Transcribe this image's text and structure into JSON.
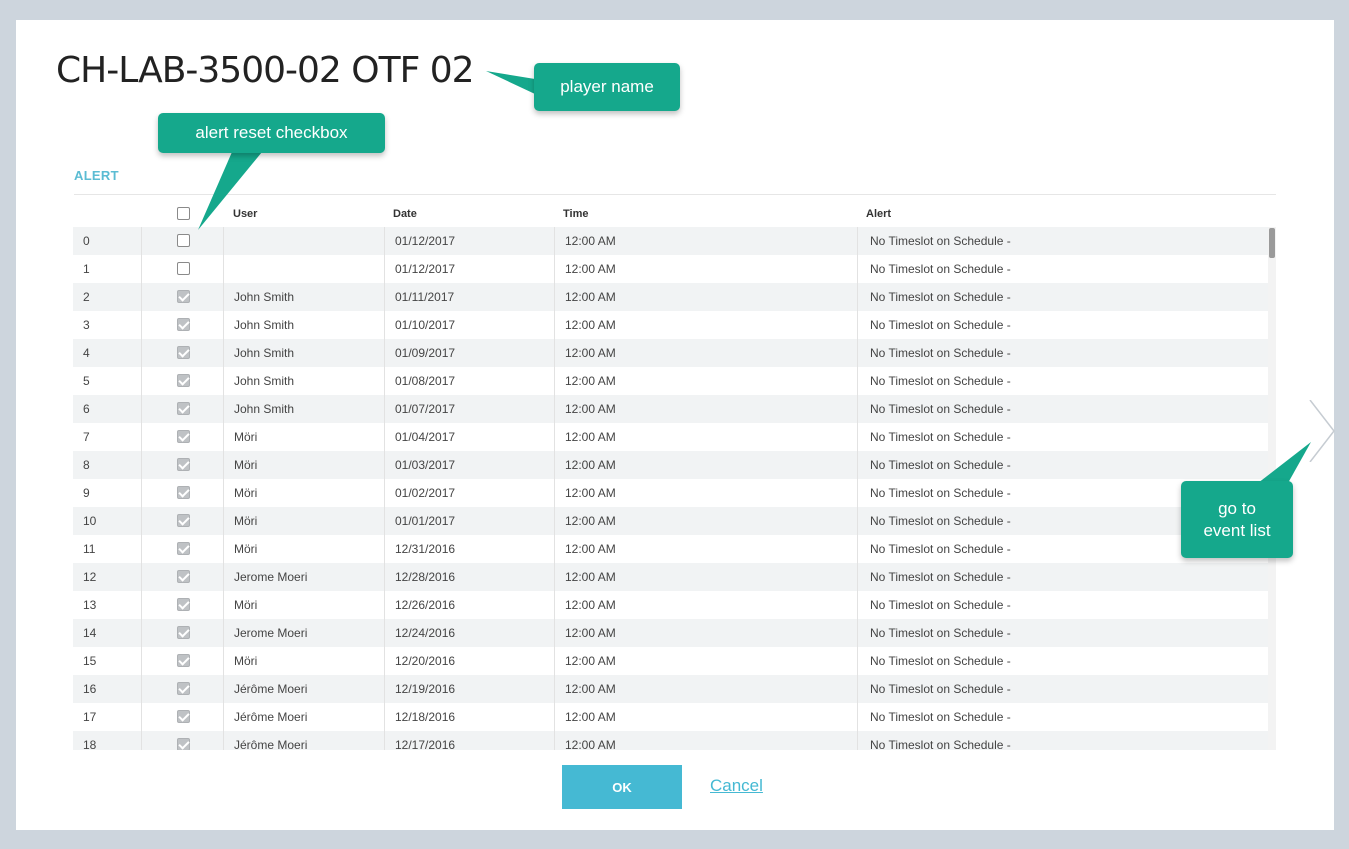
{
  "dialog": {
    "title": "CH-LAB-3500-02 OTF 02",
    "section": "ALERT"
  },
  "table": {
    "columns": {
      "user": "User",
      "date": "Date",
      "time": "Time",
      "alert": "Alert"
    },
    "rows": [
      {
        "idx": "0",
        "checked": false,
        "user": "",
        "date": "01/12/2017",
        "time": "12:00 AM",
        "alert": "No Timeslot on Schedule -"
      },
      {
        "idx": "1",
        "checked": false,
        "user": "",
        "date": "01/12/2017",
        "time": "12:00 AM",
        "alert": "No Timeslot on Schedule -"
      },
      {
        "idx": "2",
        "checked": true,
        "user": "John Smith",
        "date": "01/11/2017",
        "time": "12:00 AM",
        "alert": "No Timeslot on Schedule -"
      },
      {
        "idx": "3",
        "checked": true,
        "user": "John Smith",
        "date": "01/10/2017",
        "time": "12:00 AM",
        "alert": "No Timeslot on Schedule -"
      },
      {
        "idx": "4",
        "checked": true,
        "user": "John Smith",
        "date": "01/09/2017",
        "time": "12:00 AM",
        "alert": "No Timeslot on Schedule -"
      },
      {
        "idx": "5",
        "checked": true,
        "user": "John Smith",
        "date": "01/08/2017",
        "time": "12:00 AM",
        "alert": "No Timeslot on Schedule -"
      },
      {
        "idx": "6",
        "checked": true,
        "user": "John Smith",
        "date": "01/07/2017",
        "time": "12:00 AM",
        "alert": "No Timeslot on Schedule -"
      },
      {
        "idx": "7",
        "checked": true,
        "user": "Möri",
        "date": "01/04/2017",
        "time": "12:00 AM",
        "alert": "No Timeslot on Schedule -"
      },
      {
        "idx": "8",
        "checked": true,
        "user": "Möri",
        "date": "01/03/2017",
        "time": "12:00 AM",
        "alert": "No Timeslot on Schedule -"
      },
      {
        "idx": "9",
        "checked": true,
        "user": "Möri",
        "date": "01/02/2017",
        "time": "12:00 AM",
        "alert": "No Timeslot on Schedule -"
      },
      {
        "idx": "10",
        "checked": true,
        "user": "Möri",
        "date": "01/01/2017",
        "time": "12:00 AM",
        "alert": "No Timeslot on Schedule -"
      },
      {
        "idx": "11",
        "checked": true,
        "user": "Möri",
        "date": "12/31/2016",
        "time": "12:00 AM",
        "alert": "No Timeslot on Schedule -"
      },
      {
        "idx": "12",
        "checked": true,
        "user": "Jerome Moeri",
        "date": "12/28/2016",
        "time": "12:00 AM",
        "alert": "No Timeslot on Schedule -"
      },
      {
        "idx": "13",
        "checked": true,
        "user": "Möri",
        "date": "12/26/2016",
        "time": "12:00 AM",
        "alert": "No Timeslot on Schedule -"
      },
      {
        "idx": "14",
        "checked": true,
        "user": "Jerome Moeri",
        "date": "12/24/2016",
        "time": "12:00 AM",
        "alert": "No Timeslot on Schedule -"
      },
      {
        "idx": "15",
        "checked": true,
        "user": "Möri",
        "date": "12/20/2016",
        "time": "12:00 AM",
        "alert": "No Timeslot on Schedule -"
      },
      {
        "idx": "16",
        "checked": true,
        "user": "Jérôme Moeri",
        "date": "12/19/2016",
        "time": "12:00 AM",
        "alert": "No Timeslot on Schedule -"
      },
      {
        "idx": "17",
        "checked": true,
        "user": "Jérôme Moeri",
        "date": "12/18/2016",
        "time": "12:00 AM",
        "alert": "No Timeslot on Schedule -"
      },
      {
        "idx": "18",
        "checked": true,
        "user": "Jérôme Moeri",
        "date": "12/17/2016",
        "time": "12:00 AM",
        "alert": "No Timeslot on Schedule -"
      }
    ]
  },
  "buttons": {
    "ok": "OK",
    "cancel": "Cancel"
  },
  "callouts": {
    "player_name": "player name",
    "alert_reset": "alert reset checkbox",
    "event_list_line1": "go to",
    "event_list_line2": "event list"
  },
  "icons": {
    "next": "chevron-right-icon"
  },
  "colors": {
    "accent": "#45b9d3",
    "callout": "#15a88c",
    "background": "#cdd5dd"
  }
}
